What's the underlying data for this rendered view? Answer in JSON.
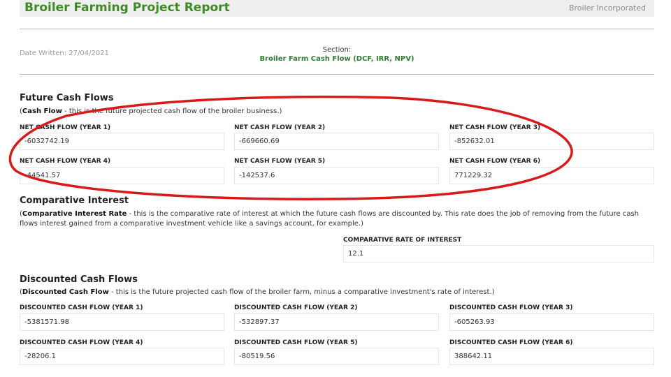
{
  "header": {
    "title": "Broiler Farming Project Report",
    "company": "Broiler Incorporated"
  },
  "meta": {
    "date_written": "Date Written: 27/04/2021",
    "section_label": "Section:",
    "section_name": "Broiler Farm Cash Flow (DCF, IRR, NPV)"
  },
  "future_cash_flows": {
    "heading": "Future Cash Flows",
    "desc_term": "Cash Flow",
    "desc_text": " - this is the future projected cash flow of the broiler business.)",
    "fields": [
      {
        "label": "NET CASH FLOW (YEAR 1)",
        "value": "-6032742.19"
      },
      {
        "label": "NET CASH FLOW (YEAR 2)",
        "value": "-669660.69"
      },
      {
        "label": "NET CASH FLOW (YEAR 3)",
        "value": "-852632.01"
      },
      {
        "label": "NET CASH FLOW (YEAR 4)",
        "value": "-44541.57"
      },
      {
        "label": "NET CASH FLOW (YEAR 5)",
        "value": "-142537.6"
      },
      {
        "label": "NET CASH FLOW (YEAR 6)",
        "value": "771229.32"
      }
    ]
  },
  "comparative_interest": {
    "heading": "Comparative Interest",
    "desc_term": "Comparative Interest Rate",
    "desc_text": " - this is the comparative rate of interest at which the future cash flows are discounted by. This rate does the job of removing from the future cash flows interest gained from a comparative investment vehicle like a savings account, for example.)",
    "field": {
      "label": "COMPARATIVE RATE OF INTEREST",
      "value": "12.1"
    }
  },
  "discounted_cash_flows": {
    "heading": "Discounted Cash Flows",
    "desc_term": "Discounted Cash Flow",
    "desc_text": " - this is the future projected cash flow of the broiler farm, minus a comparative investment's rate of interest.)",
    "fields": [
      {
        "label": "DISCOUNTED CASH FLOW (YEAR 1)",
        "value": "-5381571.98"
      },
      {
        "label": "DISCOUNTED CASH FLOW (YEAR 2)",
        "value": "-532897.37"
      },
      {
        "label": "DISCOUNTED CASH FLOW (YEAR 3)",
        "value": "-605263.93"
      },
      {
        "label": "DISCOUNTED CASH FLOW (YEAR 4)",
        "value": "-28206.1"
      },
      {
        "label": "DISCOUNTED CASH FLOW (YEAR 5)",
        "value": "-80519.56"
      },
      {
        "label": "DISCOUNTED CASH FLOW (YEAR 6)",
        "value": "388642.11"
      }
    ]
  },
  "colors": {
    "title_green": "#3f8a25",
    "annotation_red": "#d71a1a"
  }
}
